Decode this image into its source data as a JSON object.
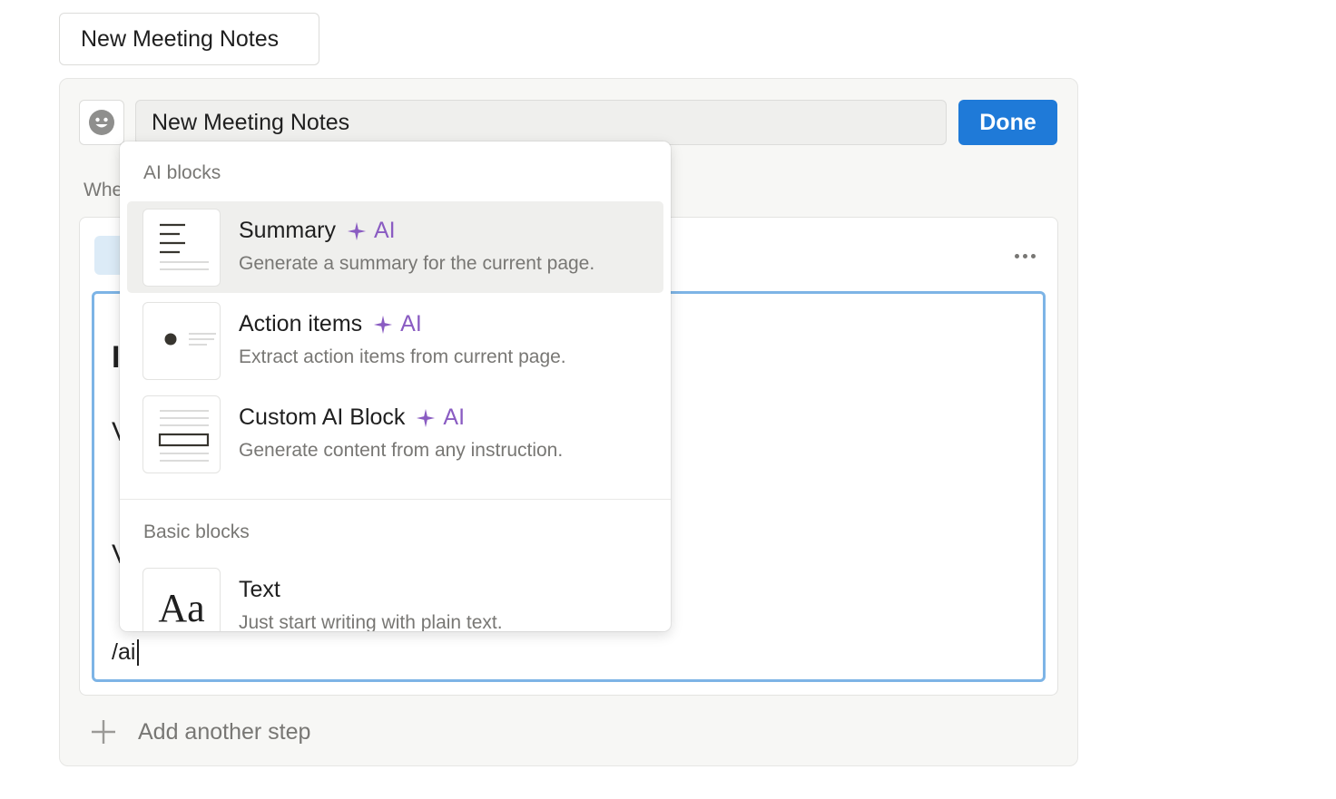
{
  "template_button": {
    "label": "New Meeting Notes"
  },
  "editor_header": {
    "emoji_icon": "smiley-face-icon",
    "name_value": "New Meeting Notes",
    "done_label": "Done"
  },
  "trigger_label_partial": "Whe",
  "step": {
    "more_icon": "ellipsis-icon",
    "typed_text": "/ai",
    "peek_letters": [
      "I",
      "V",
      "V"
    ]
  },
  "add_step_label": "Add another step",
  "block_menu": {
    "sections": [
      {
        "label": "AI blocks",
        "items": [
          {
            "title": "Summary",
            "badge": "AI",
            "description": "Generate a summary for the current page.",
            "icon": "summary-thumbnail"
          },
          {
            "title": "Action items",
            "badge": "AI",
            "description": "Extract action items from current page.",
            "icon": "action-items-thumbnail"
          },
          {
            "title": "Custom AI Block",
            "badge": "AI",
            "description": "Generate content from any instruction.",
            "icon": "custom-ai-block-thumbnail"
          }
        ]
      },
      {
        "label": "Basic blocks",
        "items": [
          {
            "title": "Text",
            "description": "Just start writing with plain text.",
            "icon_text": "Aa"
          }
        ]
      }
    ]
  },
  "colors": {
    "accent": "#1f7ad8",
    "ai_purple": "#8a5cc2",
    "editor_border": "#7db4e6",
    "hover_bg": "#efefed"
  }
}
